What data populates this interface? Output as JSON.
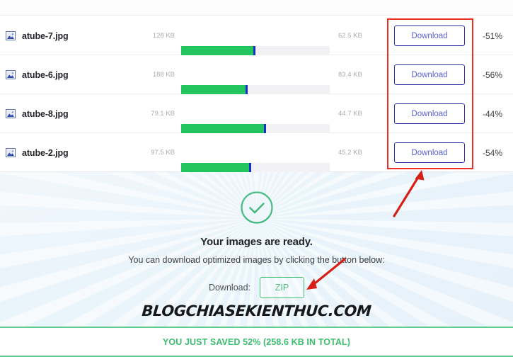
{
  "file_table": {
    "rows": [
      {
        "icon": "image-file-icon",
        "name": "atube-7.jpg",
        "size_before": "128 KB",
        "size_after": "62.5 KB",
        "bar_fill_percent": 49,
        "download_label": "Download",
        "savings": "-51%"
      },
      {
        "icon": "image-file-icon",
        "name": "atube-6.jpg",
        "size_before": "188 KB",
        "size_after": "83.4 KB",
        "bar_fill_percent": 44,
        "download_label": "Download",
        "savings": "-56%"
      },
      {
        "icon": "image-file-icon",
        "name": "atube-8.jpg",
        "size_before": "79.1 KB",
        "size_after": "44.7 KB",
        "bar_fill_percent": 56,
        "download_label": "Download",
        "savings": "-44%"
      },
      {
        "icon": "image-file-icon",
        "name": "atube-2.jpg",
        "size_before": "97.5 KB",
        "size_after": "45.2 KB",
        "bar_fill_percent": 46,
        "download_label": "Download",
        "savings": "-54%"
      }
    ]
  },
  "success_panel": {
    "check_icon": "check-circle-icon",
    "title": "Your images are ready.",
    "subtitle": "You can download optimized images by clicking the button below:",
    "download_label": "Download:",
    "zip_button_label": "ZIP",
    "watermark": "BLOGCHIASEKIENTHUC.COM"
  },
  "footer": {
    "text": "YOU JUST SAVED 52% (258.6 KB IN TOTAL)"
  },
  "annotations": {
    "box_label": "download-buttons-highlight",
    "arrow_to_box": "arrow-pointing-to-download-buttons",
    "arrow_to_zip": "arrow-pointing-to-zip-button"
  },
  "colors": {
    "bar_fill": "#22c55e",
    "bar_marker": "#1730c9",
    "bar_track": "#f2f2f4",
    "download_button_border": "#2b2f9e",
    "download_button_text": "#5b61d6",
    "zip_button_border": "#3dbd6e",
    "zip_button_text": "#4fbf7e",
    "footer_text": "#3bbd6e",
    "footer_rule": "#5fcc8d",
    "annotation_red": "#ee2d24",
    "panel_background": "#e9f3fb"
  }
}
